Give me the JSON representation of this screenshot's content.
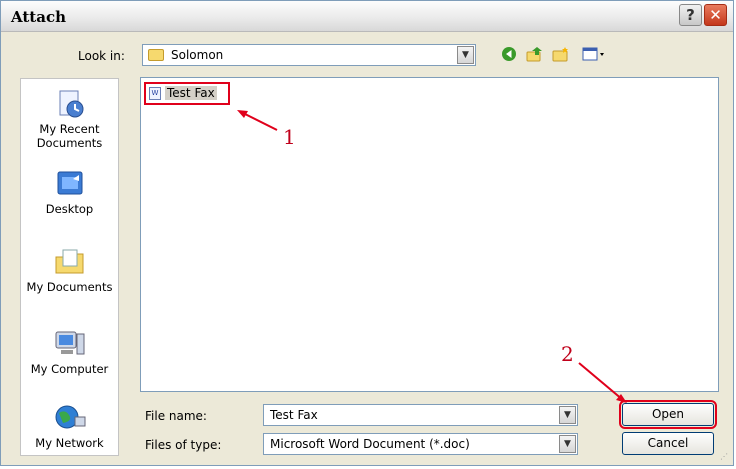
{
  "window": {
    "title": "Attach"
  },
  "title_buttons": {
    "help": "?",
    "close": "✕"
  },
  "toolbar": {
    "look_in_label": "Look in:",
    "look_in_value": "Solomon",
    "back_icon": "back-icon",
    "up_icon": "up-folder-icon",
    "new_folder_icon": "new-folder-icon",
    "views_icon": "views-menu-icon"
  },
  "places": [
    {
      "label": "My Recent Documents",
      "icon": "recent-documents-icon"
    },
    {
      "label": "Desktop",
      "icon": "desktop-icon"
    },
    {
      "label": "My Documents",
      "icon": "my-documents-icon"
    },
    {
      "label": "My Computer",
      "icon": "my-computer-icon"
    },
    {
      "label": "My Network",
      "icon": "my-network-icon"
    }
  ],
  "files": [
    {
      "name": "Test Fax",
      "type": "word-document",
      "selected": true
    }
  ],
  "form": {
    "file_name_label": "File name:",
    "file_name_value": "Test Fax",
    "file_type_label": "Files of type:",
    "file_type_value": "Microsoft Word Document (*.doc)"
  },
  "buttons": {
    "open": "Open",
    "cancel": "Cancel"
  },
  "annotations": {
    "step1": "1",
    "step2": "2"
  },
  "colors": {
    "annotation": "#e0001b",
    "window_bg": "#ece9d8",
    "border": "#7f9db9"
  }
}
